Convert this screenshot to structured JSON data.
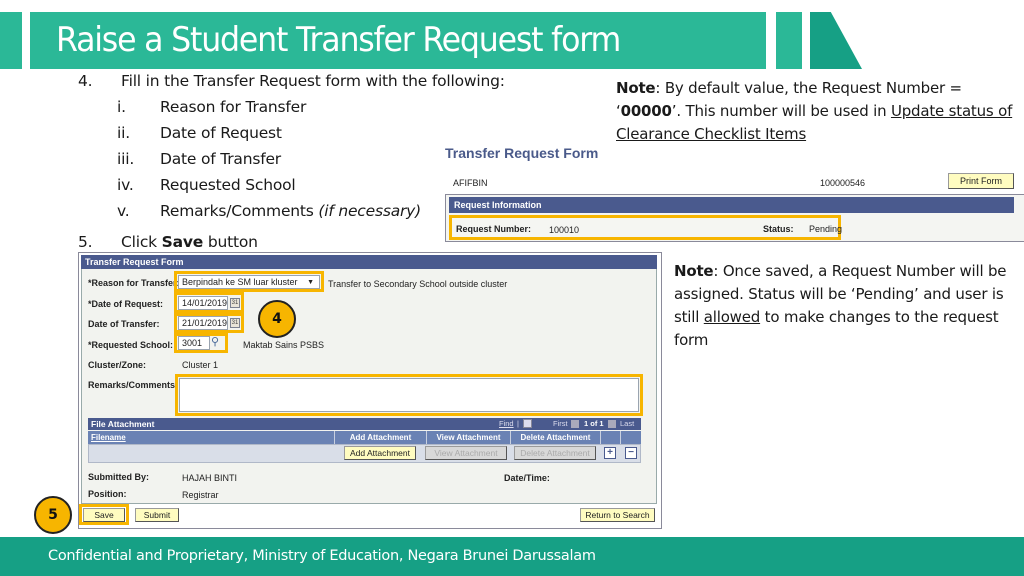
{
  "slide": {
    "title": "Raise a Student Transfer Request form",
    "footer": "Confidential and Proprietary, Ministry of Education, Negara Brunei Darussalam",
    "colors": {
      "brand_green": "#2bb897",
      "brand_dark_green": "#16a085",
      "highlight": "#f7b500",
      "ps_header": "#4a5a8e"
    }
  },
  "instructions": {
    "step4": {
      "num": "4.",
      "text": "Fill in the Transfer Request form with the following:"
    },
    "sub_items": [
      {
        "num": "i.",
        "text": "Reason for Transfer"
      },
      {
        "num": "ii.",
        "text": "Date of Request"
      },
      {
        "num": "iii.",
        "text": "Date of Transfer"
      },
      {
        "num": "iv.",
        "text": "Requested School"
      },
      {
        "num": "v.",
        "text": "Remarks/Comments ",
        "italic": "(if necessary)"
      }
    ],
    "step5": {
      "num": "5.",
      "prefix": "Click ",
      "bold": "Save",
      "suffix": " button"
    }
  },
  "notes": {
    "note1": {
      "label": "Note",
      "text1": ": By default value, the Request Number = ",
      "value": "00000",
      "text2": ". This number will be used in ",
      "link": "Update status of Clearance Checklist Items"
    },
    "note2": {
      "label": "Note",
      "text1": ": Once saved, a Request Number will be assigned. Status will be ‘Pending’ and user is still ",
      "underlined": "allowed",
      "text2": " to make changes to the request form"
    }
  },
  "request_panel": {
    "title": "Transfer Request Form",
    "user_id": "AFIFBIN",
    "employee_id": "100000546",
    "print_button": "Print Form",
    "section_header": "Request Information",
    "request_number_label": "Request Number:",
    "request_number_value": "100010",
    "status_label": "Status:",
    "status_value": "Pending"
  },
  "form": {
    "header": "Transfer Request Form",
    "fields": {
      "reason_label": "*Reason for Transfer:",
      "reason_value": "Berpindah ke SM luar kluster",
      "reason_desc": "Transfer to Secondary School outside cluster",
      "date_request_label": "*Date of Request:",
      "date_request_value": "14/01/2019",
      "date_transfer_label": "Date of Transfer:",
      "date_transfer_value": "21/01/2019",
      "school_label": "*Requested School:",
      "school_value": "3001",
      "school_name": "Maktab Sains PSBS",
      "cluster_label": "Cluster/Zone:",
      "cluster_value": "Cluster 1",
      "remarks_label": "Remarks/Comments:",
      "remarks_value": ""
    },
    "attachment_grid": {
      "title": "File Attachment",
      "find": "Find",
      "first": "First",
      "page": "1 of 1",
      "last": "Last",
      "columns": [
        "Filename",
        "Add Attachment",
        "View Attachment",
        "Delete Attachment"
      ],
      "buttons": {
        "add": "Add Attachment",
        "view": "View Attachment",
        "delete": "Delete Attachment",
        "plus": "+",
        "minus": "−"
      }
    },
    "submitted_by_label": "Submitted By:",
    "submitted_by_value": "HAJAH BINTI",
    "position_label": "Position:",
    "position_value": "Registrar",
    "datetime_label": "Date/Time:",
    "datetime_value": "",
    "buttons": {
      "save": "Save",
      "submit": "Submit",
      "return": "Return to Search"
    }
  },
  "badges": {
    "step4": "4",
    "step5": "5"
  }
}
